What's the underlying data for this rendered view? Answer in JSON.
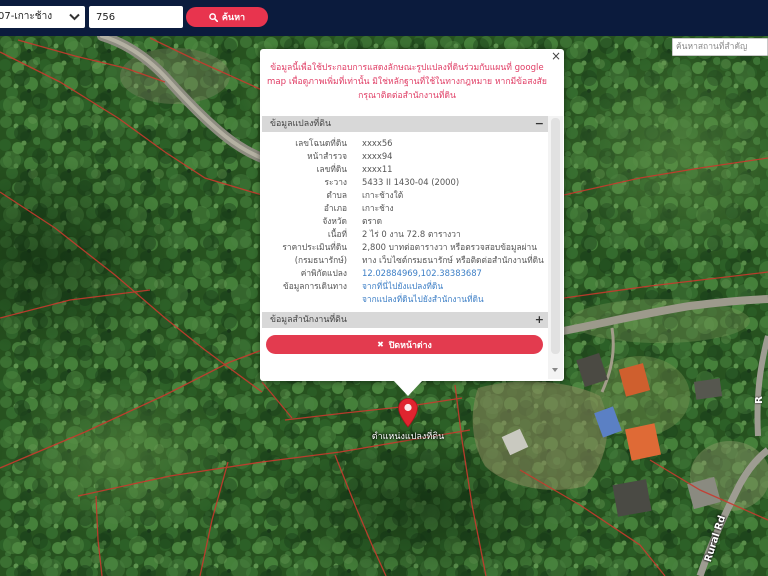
{
  "colors": {
    "header_navy": "#0b1b3d",
    "brand_red": "#e8344e",
    "disclaimer_red": "#e03c64",
    "link_blue": "#3d7fc6",
    "parcel_line_red": "#c83a2e",
    "marker_red": "#e0242f"
  },
  "search_bar": {
    "district_select": "07-เกาะช้าง",
    "dropdown_icon": "chevron-down-icon",
    "parcel_number": "756",
    "search_icon": "search-icon",
    "search_button_label": "ค้นหา"
  },
  "map": {
    "place_search_placeholder": "ค้นหาสถานที่สำคัญ",
    "marker_icon": "map-pin-icon",
    "marker_label": "ตำแหน่งแปลงที่ดิน",
    "road_label": "Rural Rd",
    "edge_road_label": "R"
  },
  "popup": {
    "close_icon": "×",
    "disclaimer_lines": [
      "ข้อมูลนี้เพื่อใช้ประกอบการแสดงลักษณะรูปแปลงที่ดินร่วมกับแผนที่ google",
      "map เพื่อดูภาพเพิ่มที่เท่านั้น มิใช่หลักฐานที่ใช้ในทางกฎหมาย หากมีข้อสงสัย",
      "กรุณาติดต่อสำนักงานที่ดิน"
    ],
    "parcel_section": {
      "title": "ข้อมูลแปลงที่ดิน",
      "toggle": "−",
      "rows": [
        {
          "label": "เลขโฉนดที่ดิน",
          "value": "xxxx56"
        },
        {
          "label": "หน้าสำรวจ",
          "value": "xxxx94"
        },
        {
          "label": "เลขที่ดิน",
          "value": "xxxx11"
        },
        {
          "label": "ระวาง",
          "value": "5433 II 1430-04 (2000)"
        },
        {
          "label": "ตำบล",
          "value": "เกาะช้างใต้"
        },
        {
          "label": "อำเภอ",
          "value": "เกาะช้าง"
        },
        {
          "label": "จังหวัด",
          "value": "ตราด"
        },
        {
          "label": "เนื้อที่",
          "value": "2 ไร่ 0 งาน 72.8 ตารางวา"
        },
        {
          "label": [
            "ราคาประเมินที่ดิน",
            "(กรมธนารักษ์)"
          ],
          "value": [
            "2,800 บาทต่อตารางวา หรือตรวจสอบข้อมูลผ่าน",
            "ทาง เว็บไซต์กรมธนารักษ์ หรือติดต่อสำนักงานที่ดิน"
          ]
        },
        {
          "label": "ค่าพิกัดแปลง",
          "value": "12.02884969,102.38383687"
        },
        {
          "label": "ข้อมูลการเดินทาง",
          "value": [
            "จากที่นี่ไปยังแปลงที่ดิน",
            "จากแปลงที่ดินไปยังสำนักงานที่ดิน"
          ]
        }
      ]
    },
    "office_section": {
      "title": "ข้อมูลสำนักงานที่ดิน",
      "toggle": "+"
    },
    "close_button_icon": "✖",
    "close_button_label": "ปิดหน้าต่าง"
  }
}
